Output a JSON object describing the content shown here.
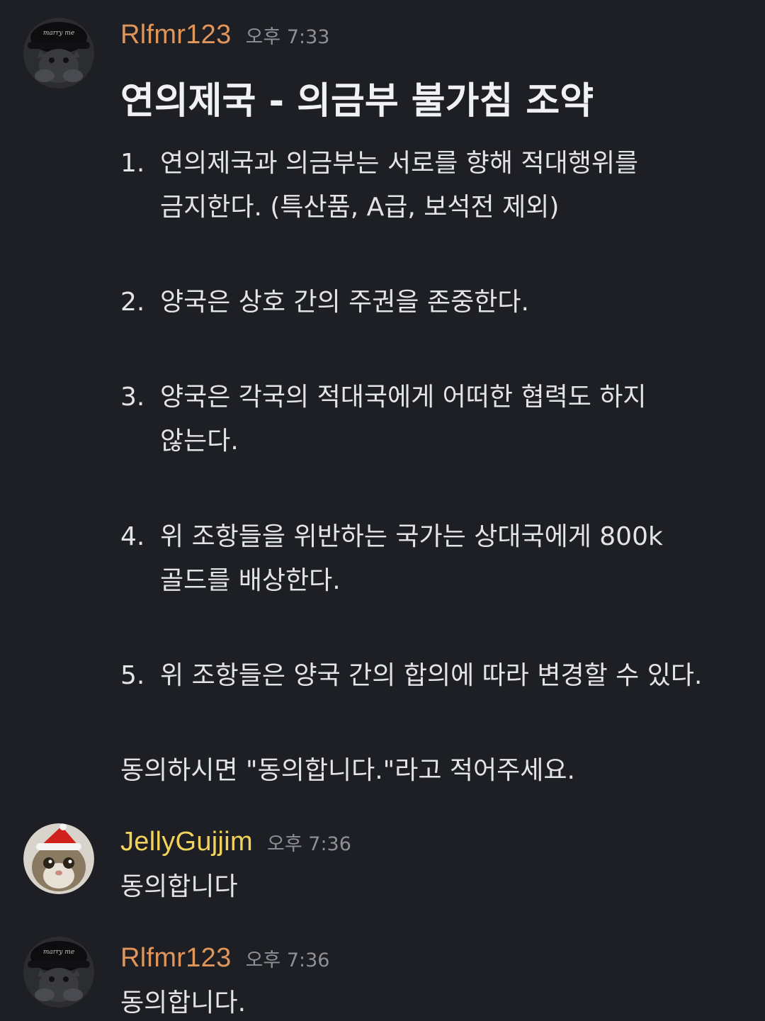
{
  "colors": {
    "background": "#1e1f24",
    "user1_name": "#e0955a",
    "user2_name": "#f2d35a",
    "timestamp": "#8e9096",
    "text": "#e3e4e8"
  },
  "messages": [
    {
      "username": "Rlfmr123",
      "timestamp": "오후 7:33",
      "avatar_icon": "cat-with-black-hat-avatar",
      "avatar_hat_text": "marry me",
      "title": "연의제국 - 의금부 불가침 조약",
      "clauses": [
        {
          "num": "1.",
          "lines": [
            "연의제국과 의금부는 서로를 향해 적대행위를",
            "금지한다. (특산품, A급, 보석전 제외)"
          ]
        },
        {
          "num": "2.",
          "lines": [
            "양국은 상호 간의 주권을 존중한다."
          ]
        },
        {
          "num": "3.",
          "lines": [
            "양국은 각국의 적대국에게 어떠한 협력도 하지",
            "않는다."
          ]
        },
        {
          "num": "4.",
          "lines": [
            "위 조항들을 위반하는 국가는 상대국에게 800k",
            "골드를 배상한다."
          ]
        },
        {
          "num": "5.",
          "lines": [
            "위 조항들은 양국 간의 합의에 따라 변경할 수 있다."
          ]
        }
      ],
      "footer": "동의하시면 \"동의합니다.\"라고 적어주세요."
    },
    {
      "username": "JellyGujjim",
      "timestamp": "오후 7:36",
      "avatar_icon": "cat-with-santa-hat-avatar",
      "text": "동의합니다"
    },
    {
      "username": "Rlfmr123",
      "timestamp": "오후 7:36",
      "avatar_icon": "cat-with-black-hat-avatar",
      "avatar_hat_text": "marry me",
      "text": "동의합니다."
    }
  ]
}
